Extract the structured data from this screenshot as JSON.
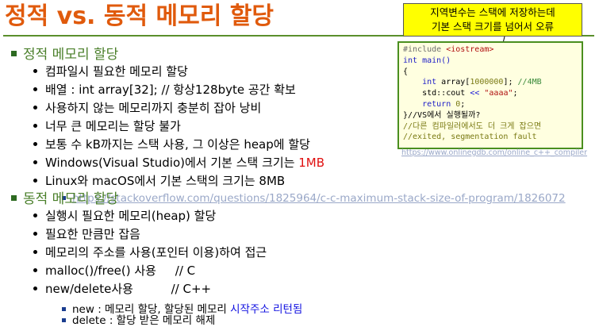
{
  "title": "정적 vs. 동적 메모리 할당",
  "callout": {
    "line1": "지역변수는 스택에 저장하는데",
    "line2": "기본 스택 크기를 넘어서 오류"
  },
  "code": {
    "line1": "#include <iostream>",
    "line2": "int main()",
    "line3": "{",
    "line4_decl": "int array[1000000];",
    "line4_comment": "//4MB",
    "line5_a": "std::cout ",
    "line5_op": "<<",
    "line5_str": "\"aaaa\"",
    "line5_end": ";",
    "line6": "return 0;",
    "line7": "}//VS에서 실행될까?",
    "line8": "//다른 컴파일러에서도 더 크게 잡으면",
    "line9": "//exited, segmentation fault"
  },
  "source_link": "https://www.onlinegdb.com/online_c++_compiler",
  "static": {
    "heading": "정적 메모리 할당",
    "items": [
      "컴파일시 필요한 메모리 할당",
      "배열 : int array[32];   // 항상128byte 공간 확보",
      "사용하지 않는 메모리까지 충분히 잡아 낭비",
      "너무 큰 메모리는 할당 불가",
      "보통 수 kB까지는 스택 사용, 그 이상은 heap에 할당"
    ],
    "windows_prefix": "Windows(Visual Studio)에서 기본 스택 크기는 ",
    "windows_value": "1MB",
    "linux": "Linux와 macOS에서 기본 스택의 크기는 8MB",
    "link": "https://stackoverflow.com/questions/1825964/c-c-maximum-stack-size-of-program/1826072"
  },
  "dynamic": {
    "heading": "동적 메모리 할당",
    "items": [
      "실행시 필요한 메모리(heap) 할당",
      "필요한 만큼만 잡음",
      "메모리의 주소를 사용(포인터 이용)하여 접근",
      "malloc()/free() 사용     // C",
      "new/delete사용          // C++"
    ],
    "new_prefix": "new : 메모리 할당, 할당된 메모리 ",
    "new_highlight": "시작주소 리턴됨",
    "delete": "delete : 할당 받은 메모리 해제"
  },
  "colors": {
    "title": "#e05a0c",
    "section": "#4a7f2a",
    "rule": "#5a8f2c",
    "callout_bg": "#ffff00",
    "code_bg": "#ffffe0",
    "highlight_red": "#e01010",
    "highlight_blue": "#1010e0"
  }
}
